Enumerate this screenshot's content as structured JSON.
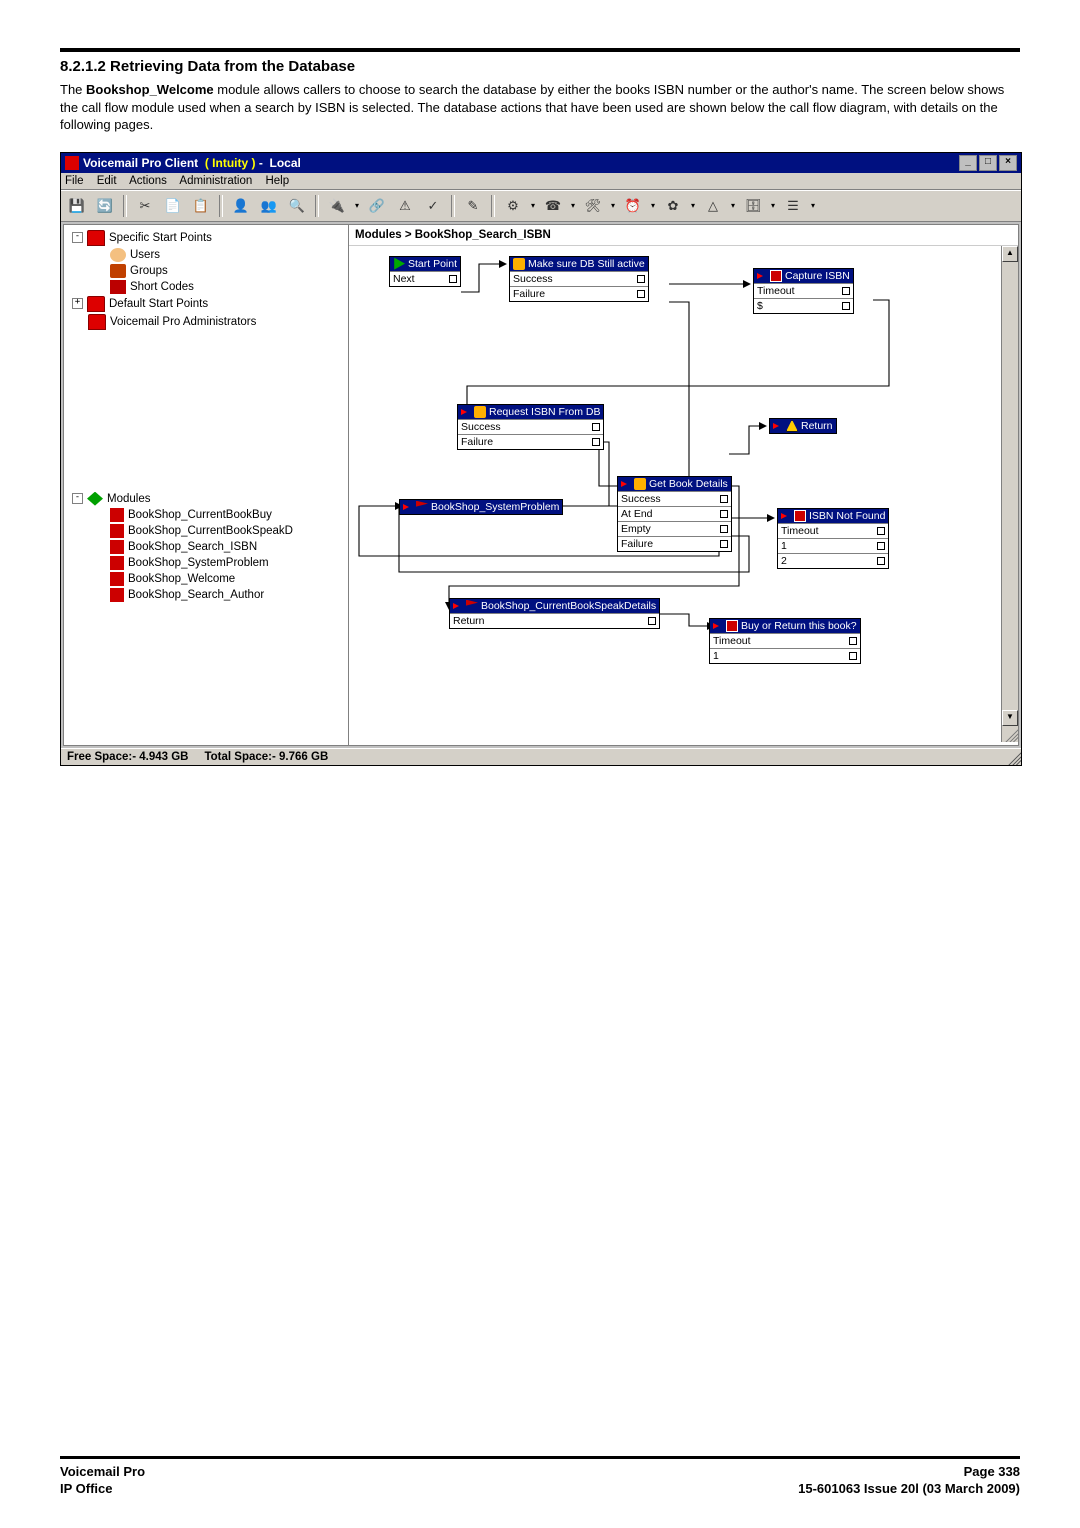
{
  "section_heading": "8.2.1.2 Retrieving Data from the Database",
  "body_text_pre": "The ",
  "body_text_bold": "Bookshop_Welcome",
  "body_text_post": " module allows callers to choose to search the database by either the books ISBN number or the author's name. The screen below shows the call flow module used when a search by ISBN is selected. The database actions that have been used are shown below the call flow diagram, with details on the following pages.",
  "titlebar": {
    "app": "Voicemail Pro Client",
    "mode": "( Intuity )",
    "sep": "-",
    "local": "Local"
  },
  "menu": [
    "File",
    "Edit",
    "Actions",
    "Administration",
    "Help"
  ],
  "tree": {
    "specific": "Specific Start Points",
    "users": "Users",
    "groups": "Groups",
    "short": "Short Codes",
    "default": "Default Start Points",
    "admins": "Voicemail Pro Administrators",
    "modules": "Modules",
    "mod_items": [
      "BookShop_CurrentBookBuy",
      "BookShop_CurrentBookSpeakD",
      "BookShop_Search_ISBN",
      "BookShop_SystemProblem",
      "BookShop_Welcome",
      "BookShop_Search_Author"
    ]
  },
  "breadcrumb": "Modules > BookShop_Search_ISBN",
  "nodes": {
    "start": {
      "title": "Start Point",
      "lines": [
        "Next"
      ]
    },
    "check": {
      "title": "Make sure DB Still active",
      "lines": [
        "Success",
        "Failure"
      ]
    },
    "capture": {
      "title": "Capture ISBN",
      "lines": [
        "Timeout",
        "$"
      ]
    },
    "request": {
      "title": "Request ISBN From DB",
      "lines": [
        "Success",
        "Failure"
      ]
    },
    "return": {
      "title": "Return",
      "lines": []
    },
    "getbook": {
      "title": "Get Book Details",
      "lines": [
        "Success",
        "At End",
        "Empty",
        "Failure"
      ]
    },
    "sysprob": {
      "title": "BookShop_SystemProblem",
      "lines": []
    },
    "notfound": {
      "title": "ISBN Not Found",
      "lines": [
        "Timeout",
        "1",
        "2"
      ]
    },
    "speak": {
      "title": "BookShop_CurrentBookSpeakDetails",
      "lines": [
        "Return"
      ]
    },
    "buy": {
      "title": "Buy or Return this book?",
      "lines": [
        "Timeout",
        "1"
      ]
    }
  },
  "status": {
    "free_label": "Free Space:-",
    "free_value": "4.943 GB",
    "total_label": "Total Space:-",
    "total_value": "9.766 GB"
  },
  "footer": {
    "left1": "Voicemail Pro",
    "left2": "IP Office",
    "right1": "Page 338",
    "right2": "15-601063 Issue 20l (03 March 2009)"
  }
}
